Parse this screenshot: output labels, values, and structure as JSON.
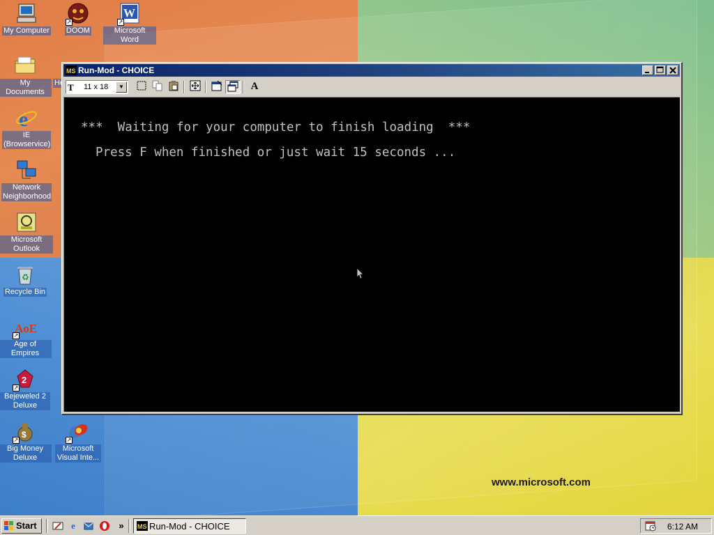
{
  "desktop": {
    "brand_url": "www.microsoft.com",
    "icons_col1": [
      {
        "label": "My Computer",
        "icon": "my-computer-icon"
      },
      {
        "label": "My Documents",
        "icon": "folder-icon"
      },
      {
        "label": "IE (Browservice)",
        "icon": "internet-explorer-icon"
      },
      {
        "label": "Network Neighborhood",
        "icon": "network-icon"
      },
      {
        "label": "Microsoft Outlook",
        "icon": "outlook-icon"
      },
      {
        "label": "Recycle Bin",
        "icon": "recycle-bin-icon"
      },
      {
        "label": "Age of Empires",
        "icon": "age-of-empires-icon"
      },
      {
        "label": "Bejeweled 2 Deluxe",
        "icon": "bejeweled-icon"
      },
      {
        "label": "Big Money Deluxe",
        "icon": "money-bag-icon"
      }
    ],
    "icons_col2": [
      {
        "label": "DOOM",
        "icon": "doom-icon"
      },
      {
        "label": "Microsoft Word",
        "icon": "word-icon"
      },
      {
        "label": "Microsoft Visual Inte...",
        "icon": "visual-interdev-icon"
      }
    ],
    "partial_label_he": "He"
  },
  "window": {
    "title": "Run-Mod - CHOICE",
    "font_size_value": "11 x 18",
    "console_lines": [
      "***  Waiting for your computer to finish loading  ***",
      "Press F when finished or just wait 15 seconds ..."
    ]
  },
  "taskbar": {
    "start_label": "Start",
    "task_label": "Run-Mod - CHOICE",
    "overflow": "»",
    "clock": "6:12 AM"
  },
  "colors": {
    "title_active": "#0a246a",
    "console_bg": "#000000",
    "console_fg": "#c0c0c0",
    "chrome": "#d4d0c8"
  }
}
